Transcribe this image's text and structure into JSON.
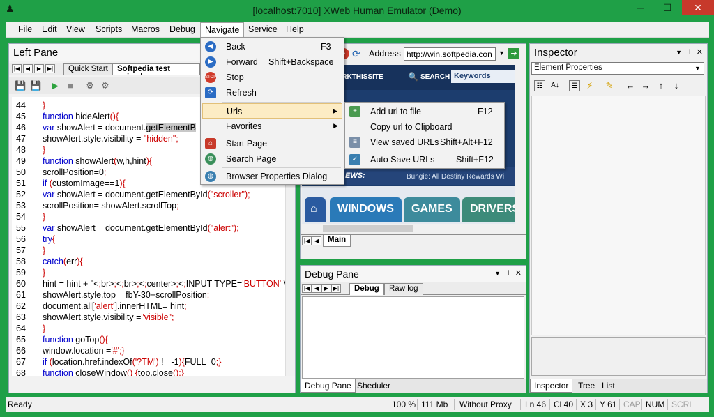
{
  "window": {
    "title": "[localhost:7010] XWeb Human Emulator (Demo)",
    "minimize": "─",
    "maximize": "☐",
    "close": "✕"
  },
  "menubar": [
    "File",
    "Edit",
    "View",
    "Scripts",
    "Macros",
    "Debug",
    "Navigate",
    "Service",
    "Help"
  ],
  "left_pane": {
    "title": "Left Pane",
    "tabs": [
      "Quick Start",
      "Softpedia test quiz.ph"
    ],
    "code": [
      {
        "n": "44",
        "t": "}"
      },
      {
        "n": "45",
        "t": "function hideAlert(){"
      },
      {
        "n": "46",
        "t": "var showAlert = document.getElementB"
      },
      {
        "n": "47",
        "t": "showAlert.style.visibility = \"hidden\";"
      },
      {
        "n": "48",
        "t": "}"
      },
      {
        "n": "49",
        "t": "function showAlert(w,h,hint){"
      },
      {
        "n": "50",
        "t": "scrollPosition=0;"
      },
      {
        "n": "51",
        "t": "if (customImage==1){"
      },
      {
        "n": "52",
        "t": "var showAlert = document.getElementById(\"scroller\");"
      },
      {
        "n": "53",
        "t": "scrollPosition= showAlert.scrollTop;"
      },
      {
        "n": "54",
        "t": "}"
      },
      {
        "n": "55",
        "t": "var showAlert = document.getElementById(\"alert\");"
      },
      {
        "n": "56",
        "t": "try{"
      },
      {
        "n": "57",
        "t": "}"
      },
      {
        "n": "58",
        "t": "catch(err){"
      },
      {
        "n": "59",
        "t": "}"
      },
      {
        "n": "60",
        "t": "hint = hint + \"<br><br><center><INPUT TYPE='BUTTON' V"
      },
      {
        "n": "61",
        "t": "showAlert.style.top = fbY-30+scrollPosition;"
      },
      {
        "n": "62",
        "t": "document.all['alert'].innerHTML= hint;"
      },
      {
        "n": "63",
        "t": "showAlert.style.visibility =\"visible\";"
      },
      {
        "n": "64",
        "t": "}"
      },
      {
        "n": "65",
        "t": "function goTop(){"
      },
      {
        "n": "66",
        "t": "window.location ='#';}"
      },
      {
        "n": "67",
        "t": "if (location.href.indexOf('?TM') != -1){FULL=0;}"
      },
      {
        "n": "68",
        "t": "function closeWindow() {top.close();}"
      }
    ]
  },
  "browser": {
    "address_label": "Address",
    "address_value": "http://win.softpedia.con",
    "site_link": "ARKTHISSITE",
    "search_label": "SEARCH",
    "search_placeholder": "Keywords",
    "news_label": "EWS:",
    "news_ticker": "Bungie: All Destiny Rewards Wi",
    "nav_tabs": [
      "WINDOWS",
      "GAMES",
      "DRIVERS"
    ],
    "home_icon": "⌂",
    "tabs": [
      "Main"
    ],
    "colors": {
      "site_bg": "#1c3d6e",
      "windows_tab": "#2a7ab8",
      "games_tab": "#3d8b9c",
      "drivers_tab": "#3d8b7a"
    }
  },
  "debug_pane": {
    "title": "Debug Pane",
    "tabs": [
      "Debug",
      "Raw log"
    ],
    "bottom_tabs": [
      "Debug Pane",
      "Sheduler"
    ]
  },
  "inspector": {
    "title": "Inspector",
    "select_value": "Element Properties",
    "bottom_tabs": [
      "Inspector",
      "Tree",
      "List"
    ]
  },
  "navigate_menu": [
    {
      "label": "Back",
      "shortcut": "F3",
      "icon": "back-arrow-icon"
    },
    {
      "label": "Forward",
      "shortcut": "Shift+Backspace",
      "icon": "forward-arrow-icon"
    },
    {
      "label": "Stop",
      "shortcut": "",
      "icon": "stop-icon"
    },
    {
      "label": "Refresh",
      "shortcut": "",
      "icon": "refresh-icon"
    },
    {
      "label": "Urls",
      "shortcut": "",
      "icon": ""
    },
    {
      "label": "Favorites",
      "shortcut": "",
      "icon": ""
    },
    {
      "label": "Start Page",
      "shortcut": "",
      "icon": "home-icon"
    },
    {
      "label": "Search Page",
      "shortcut": "",
      "icon": "globe-icon"
    },
    {
      "label": "Browser Properties Dialog",
      "shortcut": "",
      "icon": "globe-icon"
    }
  ],
  "urls_submenu": [
    {
      "label": "Add url to file",
      "shortcut": "F12"
    },
    {
      "label": "Copy url to Clipboard",
      "shortcut": ""
    },
    {
      "label": "View saved URLs",
      "shortcut": "Shift+Alt+F12"
    },
    {
      "label": "Auto Save URLs",
      "shortcut": "Shift+F12"
    }
  ],
  "status": {
    "ready": "Ready",
    "zoom": "100 %",
    "memory": "111 Mb",
    "proxy": "Without Proxy",
    "line": "Ln 46",
    "col": "Cl 40",
    "x": "X 3",
    "y": "Y 61",
    "cap": "CAP",
    "num": "NUM",
    "scrl": "SCRL"
  },
  "colors": {
    "frame": "#1fa047",
    "close": "#c7392b",
    "menu_hover": "#fcecc4"
  }
}
